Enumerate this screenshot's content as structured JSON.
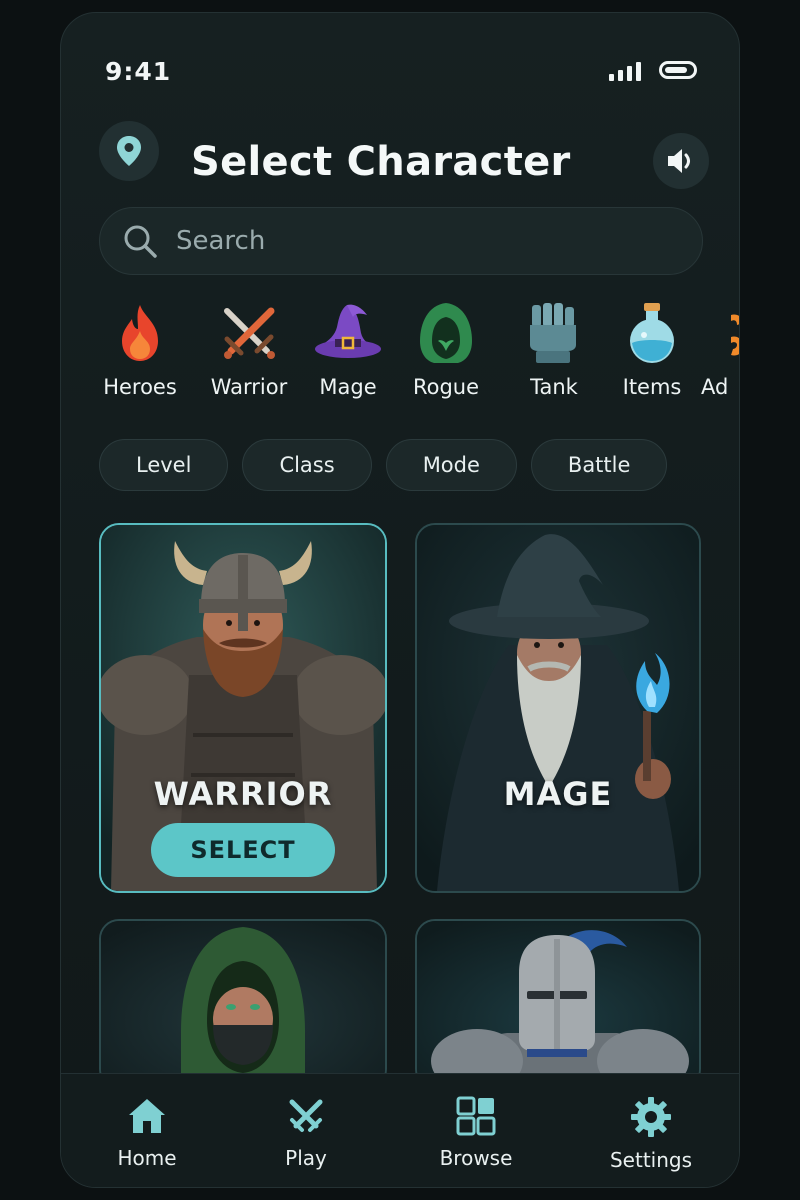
{
  "status_bar": {
    "time": "9:41"
  },
  "header": {
    "title": "Select Character",
    "location_icon": "map-pin-icon",
    "sound_icon": "speaker-icon"
  },
  "search": {
    "placeholder": "Search",
    "value": ""
  },
  "categories": [
    {
      "label": "Heroes",
      "icon": "fire-icon"
    },
    {
      "label": "Warrior",
      "icon": "crossed-swords-icon"
    },
    {
      "label": "Mage",
      "icon": "wizard-hat-icon"
    },
    {
      "label": "Rogue",
      "icon": "hood-icon"
    },
    {
      "label": "Tank",
      "icon": "gauntlet-icon"
    },
    {
      "label": "Items",
      "icon": "potion-icon"
    },
    {
      "label": "Ad",
      "icon": "partial-icon"
    }
  ],
  "filters": [
    "Level",
    "Class",
    "Mode",
    "Battle"
  ],
  "characters": [
    {
      "name": "WARRIOR",
      "selected": true,
      "action": "SELECT"
    },
    {
      "name": "MAGE",
      "selected": false
    },
    {
      "name": "",
      "selected": false
    },
    {
      "name": "",
      "selected": false
    }
  ],
  "bottom_nav": [
    {
      "label": "Home",
      "icon": "home-icon"
    },
    {
      "label": "Play",
      "icon": "crossed-swords-icon"
    },
    {
      "label": "Browse",
      "icon": "grid-icon"
    },
    {
      "label": "Settings",
      "icon": "gear-icon"
    }
  ],
  "colors": {
    "background": "#0c1112",
    "panel": "#162021",
    "accent": "#5cc6c8",
    "selected_border": "#58bcc0"
  }
}
